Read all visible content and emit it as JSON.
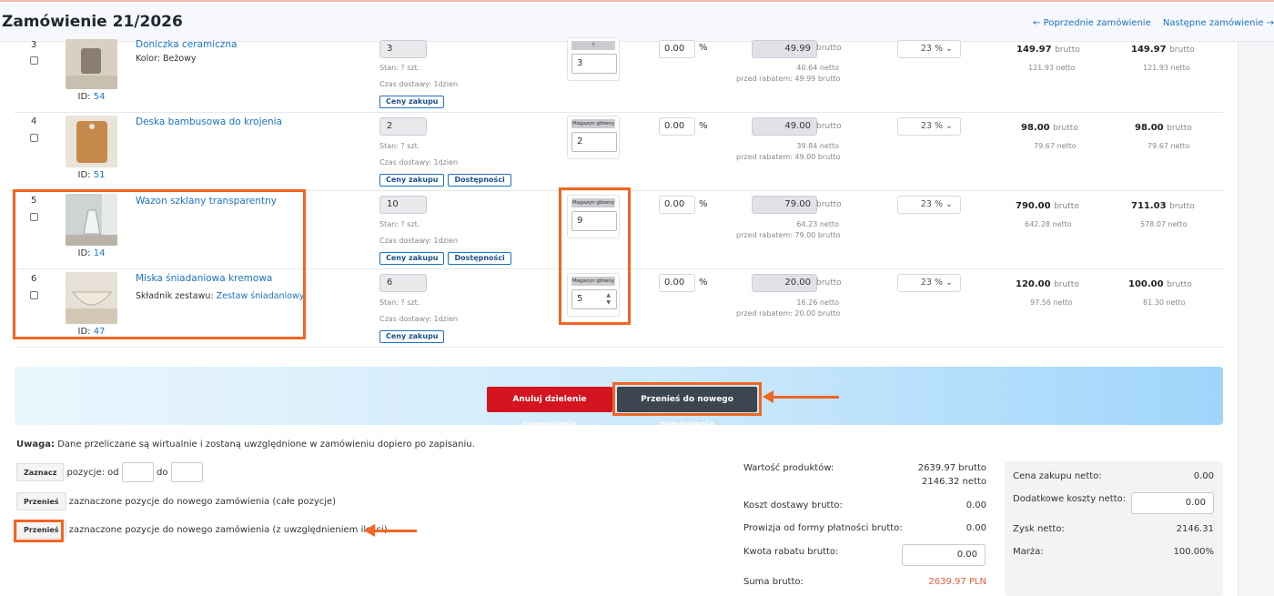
{
  "header": {
    "title": "Zamówienie 21/2026",
    "prev": "Poprzednie zamówienie",
    "next": "Następne zamówienie"
  },
  "rows": [
    {
      "lp": "3",
      "id_label": "ID:",
      "id": "54",
      "name": "Doniczka ceramiczna",
      "sub_label": "Kolor:",
      "sub_value": "Beżowy",
      "qty": "3",
      "stan": "Stan: ? szt.",
      "czas": "Czas dostawy: 1dzien",
      "btn1": "Ceny zakupu",
      "btn2": "",
      "mag_label": "?",
      "mag_value": "3",
      "disc": "0.00",
      "pct": "%",
      "price": "49.99",
      "price_unit": "brutto",
      "netto": "40.64 netto",
      "before": "przed rabatem: 49.99 brutto",
      "vat": "23 %",
      "tot1": "149.97",
      "tot1_unit": "brutto",
      "tot1_net": "121.93 netto",
      "tot2": "149.97",
      "tot2_unit": "brutto",
      "tot2_net": "121.93 netto"
    },
    {
      "lp": "4",
      "id_label": "ID:",
      "id": "51",
      "name": "Deska bambusowa do krojenia",
      "sub_label": "",
      "sub_value": "",
      "qty": "2",
      "stan": "Stan: ? szt.",
      "czas": "Czas dostawy: 1dzien",
      "btn1": "Ceny zakupu",
      "btn2": "Dostępności",
      "mag_label": "Magazyn główny",
      "mag_value": "2",
      "disc": "0.00",
      "pct": "%",
      "price": "49.00",
      "price_unit": "brutto",
      "netto": "39.84 netto",
      "before": "przed rabatem: 49.00 brutto",
      "vat": "23 %",
      "tot1": "98.00",
      "tot1_unit": "brutto",
      "tot1_net": "79.67 netto",
      "tot2": "98.00",
      "tot2_unit": "brutto",
      "tot2_net": "79.67 netto"
    },
    {
      "lp": "5",
      "id_label": "ID:",
      "id": "14",
      "name": "Wazon szklany transparentny",
      "sub_label": "",
      "sub_value": "",
      "qty": "10",
      "stan": "Stan: ? szt.",
      "czas": "Czas dostawy: 1dzien",
      "btn1": "Ceny zakupu",
      "btn2": "Dostępności",
      "mag_label": "Magazyn główny",
      "mag_value": "9",
      "disc": "0.00",
      "pct": "%",
      "price": "79.00",
      "price_unit": "brutto",
      "netto": "64.23 netto",
      "before": "przed rabatem: 79.00 brutto",
      "vat": "23 %",
      "tot1": "790.00",
      "tot1_unit": "brutto",
      "tot1_net": "642.28 netto",
      "tot2": "711.03",
      "tot2_unit": "brutto",
      "tot2_net": "578.07 netto"
    },
    {
      "lp": "6",
      "id_label": "ID:",
      "id": "47",
      "name": "Miska śniadaniowa kremowa",
      "sub_label": "Składnik zestawu:",
      "sub_value": "Zestaw śniadaniowy",
      "qty": "6",
      "stan": "Stan: ? szt.",
      "czas": "Czas dostawy: 1dzien",
      "btn1": "Ceny zakupu",
      "btn2": "",
      "mag_label": "Magazyn główny",
      "mag_value": "5",
      "disc": "0.00",
      "pct": "%",
      "price": "20.00",
      "price_unit": "brutto",
      "netto": "16.26 netto",
      "before": "przed rabatem: 20.00 brutto",
      "vat": "23 %",
      "tot1": "120.00",
      "tot1_unit": "brutto",
      "tot1_net": "97.56 netto",
      "tot2": "100.00",
      "tot2_unit": "brutto",
      "tot2_net": "81.30 netto"
    }
  ],
  "actions": {
    "cancel": "Anuluj dzielenie zamówienia",
    "move": "Przenieś do nowego zamówienia"
  },
  "note": {
    "bold": "Uwaga:",
    "text": "Dane przeliczane są wirtualnie i zostaną uwzględnione w zamówieniu dopiero po zapisaniu."
  },
  "bulk": {
    "select_btn": "Zaznacz",
    "from_label": "pozycje: od",
    "to_label": "do",
    "move_btn": "Przenieś",
    "move_full_text": "zaznaczone pozycje do nowego zamówienia (całe pozycje)",
    "move_qty_text": "zaznaczone pozycje do nowego zamówienia (z uwzględnieniem ilości)"
  },
  "summary": {
    "products_label": "Wartość produktów:",
    "products_brutto": "2639.97 brutto",
    "products_netto": "2146.32 netto",
    "shipping_label": "Koszt dostawy brutto:",
    "shipping": "0.00",
    "fee_label": "Prowizja od formy płatności brutto:",
    "fee": "0.00",
    "discount_label": "Kwota rabatu brutto:",
    "discount": "0.00",
    "total_label": "Suma brutto:",
    "total": "2639.97 PLN"
  },
  "profit": {
    "purchase_label": "Cena zakupu netto:",
    "purchase": "0.00",
    "extra_label": "Dodatkowe koszty netto:",
    "extra": "0.00",
    "profit_label": "Zysk netto:",
    "profit": "2146.31",
    "margin_label": "Marża:",
    "margin": "100.00%"
  },
  "colors": {
    "accent": "#1a73c8",
    "highlight": "#f26522",
    "danger": "#d4141f",
    "dark": "#3b4650",
    "total": "#e05a3a"
  }
}
